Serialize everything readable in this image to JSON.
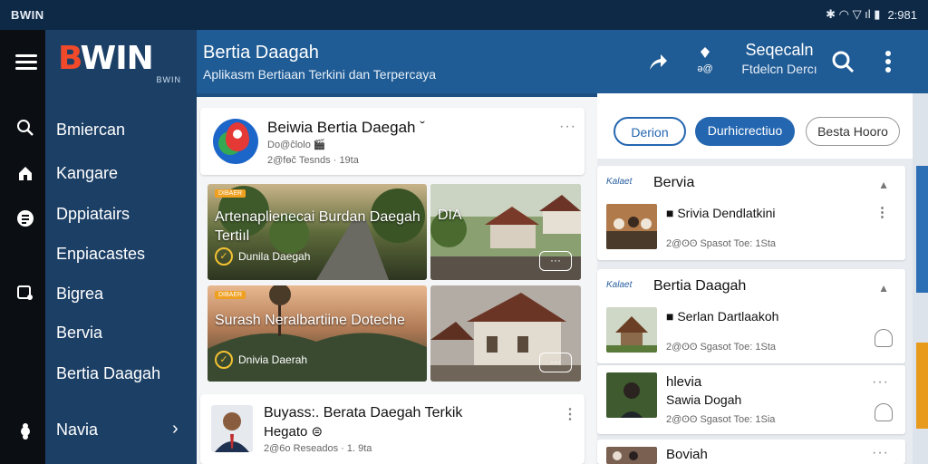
{
  "status_bar": {
    "left_label": "BWIN",
    "right_glyphs": "✱ ◠ ▽ ıl ▮",
    "time": "2:981"
  },
  "brand": {
    "logo_b": "B",
    "logo_rest": "WIN",
    "logo_sub": "BWIN"
  },
  "header": {
    "title": "Bertia Daagah",
    "subtitle": "Aplikasm Bertiaan Terkini dan Terpercaya",
    "pin_label": "ə@",
    "region_line1": "Seqecaln",
    "region_line2": "Ftdelcn Dercı"
  },
  "sidebar": {
    "items": [
      {
        "label": "Bmiercan"
      },
      {
        "label": "Kangare"
      },
      {
        "label": "Dppiatairs"
      },
      {
        "label": "Enpiacastes"
      },
      {
        "label": "Bigrea"
      },
      {
        "label": "Bervia"
      },
      {
        "label": "Bertia Daagah"
      },
      {
        "label": "Navia"
      }
    ],
    "arrow": "›"
  },
  "feed": {
    "top_post": {
      "title": "Beiwia Bertia Daegah ˇ",
      "meta1": "Do@ĉlolo 🎬",
      "meta2": "2@fɵč Tesnds · 19ta",
      "dots": "···"
    },
    "tiles": [
      {
        "badge": "DIBAER",
        "caption": "Artenaplienecai Burdan Daegah Tertiıl",
        "source": "Dunila Daegah"
      },
      {
        "badge": "",
        "caption": "DIA",
        "source": "",
        "pill": "···"
      },
      {
        "badge": "DIBAER",
        "caption": "Surash Neralbartiine Doteche",
        "source": "Dnivia Daerah"
      },
      {
        "badge": "",
        "caption": "",
        "source": "",
        "pill": "···"
      }
    ],
    "bottom_post": {
      "title": "Buyass:. Berata Daegah Terkik",
      "title2": "Hegato ⊜",
      "meta": "2@6o Reseados · 1. 9ta",
      "dots": "⋮"
    }
  },
  "right_panel": {
    "tabs": [
      "Derion",
      "Durhicrectiuo",
      "Besta Hooro"
    ],
    "cards": [
      {
        "kicker": "Kalaet",
        "heading": "Bervia",
        "line1": "■ Srivia Dendlatkini",
        "line2": "2@ʘʘ Spasot Toe: 1Sta"
      },
      {
        "kicker": "Kalaet",
        "heading": "Bertia Daagah",
        "line1": "■ Serlan Dartlaakoh",
        "line2": "2@ʘʘ Sgasot Toe: 1Sta"
      },
      {
        "kicker": "",
        "heading": "",
        "line1": "hlevia",
        "line1b": "Sawia Dogah",
        "line2": "2@ʘʘ Sgasot Toe: 1Sia"
      },
      {
        "kicker": "",
        "heading": "",
        "line1": "Boviah",
        "line2": ""
      }
    ]
  },
  "colors": {
    "header_blue": "#1f5b94",
    "sidebar_blue": "#1c3f66",
    "accent_blue": "#2466b0",
    "logo_orange": "#f04a2a"
  }
}
